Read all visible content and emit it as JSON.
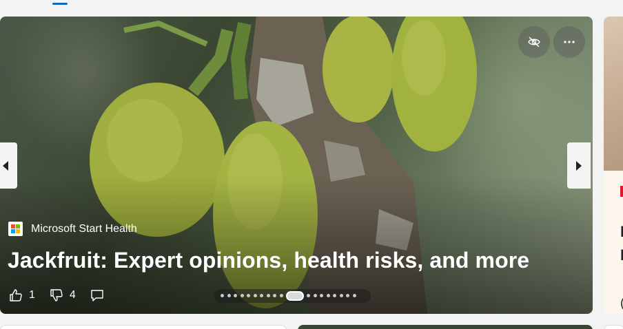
{
  "hero": {
    "source": "Microsoft Start Health",
    "headline": "Jackfruit: Expert opinions, health risks, and more",
    "likes": "1",
    "dislikes": "4",
    "pager": {
      "total": 19,
      "active_index": 10
    }
  },
  "side_card": {
    "badge_color": "#e5132c",
    "text_fragments": [
      "I",
      "I",
      "("
    ]
  },
  "icons": {
    "hide": "eye-off-icon",
    "more": "more-horizontal-icon",
    "prev": "chevron-left-icon",
    "next": "chevron-right-icon",
    "like": "thumbs-up-icon",
    "dislike": "thumbs-down-icon",
    "comment": "comment-icon"
  },
  "colors": {
    "accent": "#0f6cbd",
    "ms_logo": [
      "#f25022",
      "#7fba00",
      "#00a4ef",
      "#ffb900"
    ]
  }
}
